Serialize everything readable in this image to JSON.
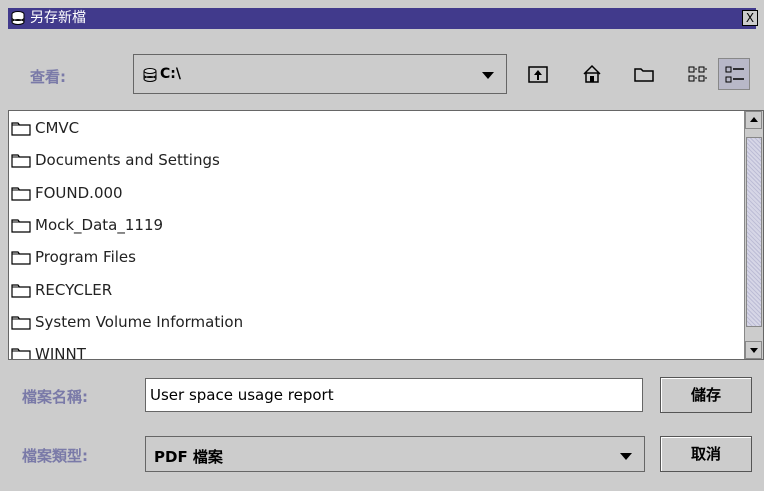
{
  "window": {
    "title": "另存新檔",
    "close_label": "X"
  },
  "lookin": {
    "label": "查看:",
    "value": "C:\\"
  },
  "files": [
    "CMVC",
    "Documents and Settings",
    "FOUND.000",
    "Mock_Data_1119",
    "Program Files",
    "RECYCLER",
    "System Volume Information",
    "WINNT"
  ],
  "filename": {
    "label": "檔案名稱:",
    "value": "User space usage report"
  },
  "filetype": {
    "label": "檔案類型:",
    "value": "PDF 檔案"
  },
  "buttons": {
    "save": "儲存",
    "cancel": "取消"
  },
  "colors": {
    "titlebar": "#413a8c",
    "label": "#7a7aa8",
    "background": "#cccccc"
  }
}
